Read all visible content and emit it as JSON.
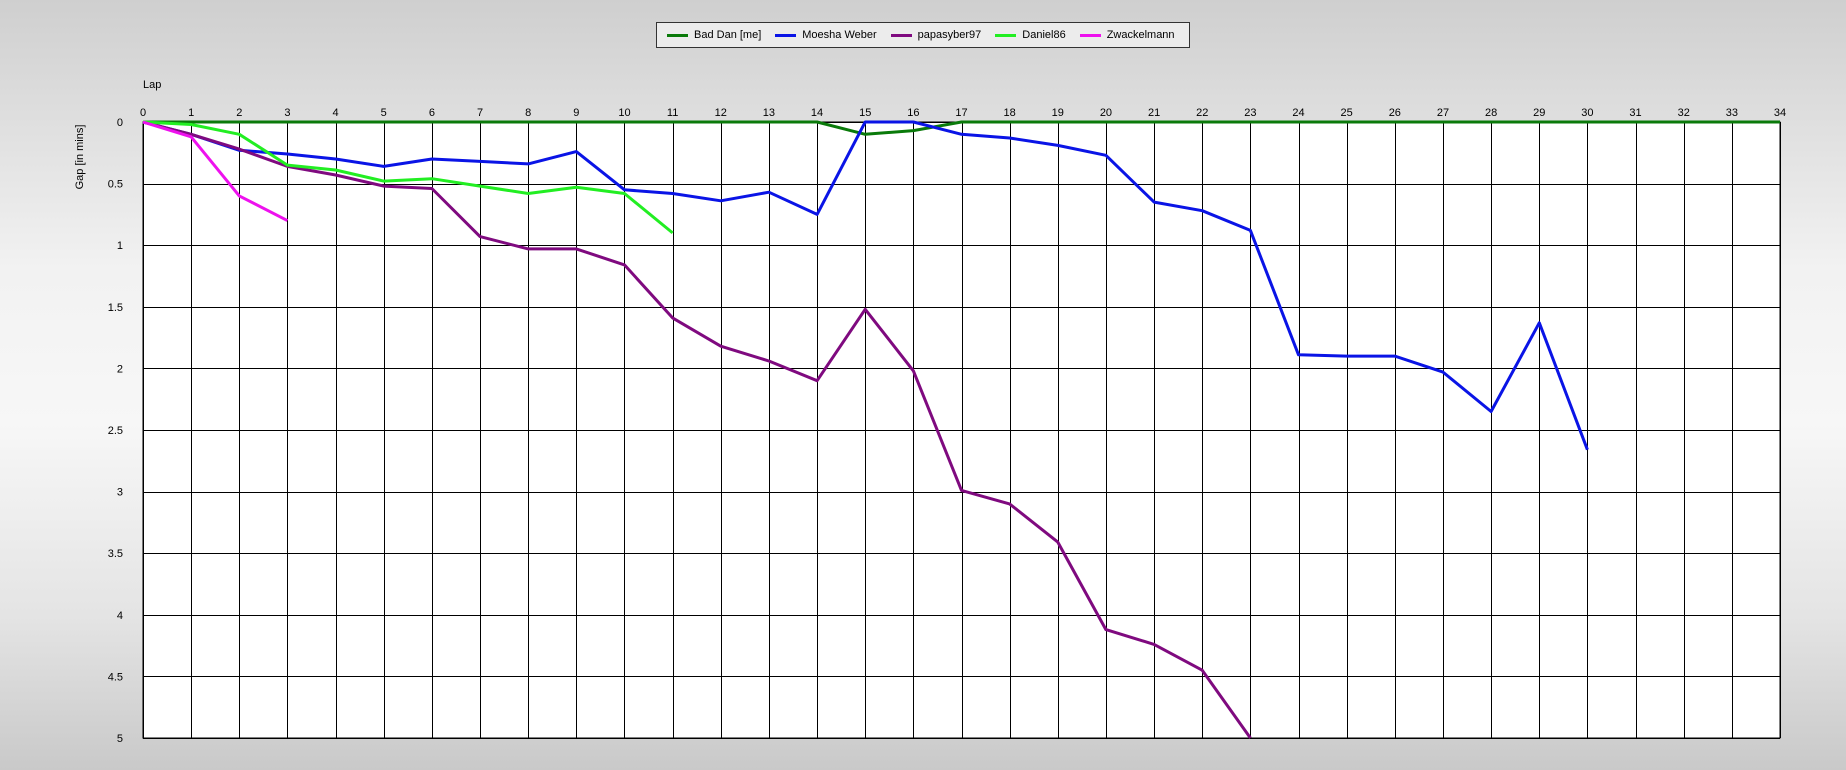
{
  "chart_data": {
    "type": "line",
    "xlabel": "Lap",
    "ylabel": "Gap [in mins]",
    "xlim": [
      0,
      34
    ],
    "ylim": [
      0,
      5
    ],
    "x_ticks": [
      0,
      1,
      2,
      3,
      4,
      5,
      6,
      7,
      8,
      9,
      10,
      11,
      12,
      13,
      14,
      15,
      16,
      17,
      18,
      19,
      20,
      21,
      22,
      23,
      24,
      25,
      26,
      27,
      28,
      29,
      30,
      31,
      32,
      33,
      34
    ],
    "y_ticks": [
      0,
      0.5,
      1,
      1.5,
      2,
      2.5,
      3,
      3.5,
      4,
      4.5,
      5
    ],
    "grid": true,
    "legend_position": "top-center",
    "y_axis_inverted": true,
    "series": [
      {
        "name": "Bad Dan [me]",
        "color": "#0a7a0a",
        "points": [
          [
            0,
            0
          ],
          [
            1,
            0
          ],
          [
            2,
            0
          ],
          [
            3,
            0
          ],
          [
            4,
            0
          ],
          [
            5,
            0
          ],
          [
            6,
            0
          ],
          [
            7,
            0
          ],
          [
            8,
            0
          ],
          [
            9,
            0
          ],
          [
            10,
            0
          ],
          [
            11,
            0
          ],
          [
            12,
            0
          ],
          [
            13,
            0
          ],
          [
            14,
            0
          ],
          [
            15,
            0.1
          ],
          [
            16,
            0.07
          ],
          [
            17,
            0
          ],
          [
            18,
            0
          ],
          [
            19,
            0
          ],
          [
            20,
            0
          ],
          [
            21,
            0
          ],
          [
            22,
            0
          ],
          [
            23,
            0
          ],
          [
            24,
            0
          ],
          [
            25,
            0
          ],
          [
            26,
            0
          ],
          [
            27,
            0
          ],
          [
            28,
            0
          ],
          [
            29,
            0
          ],
          [
            30,
            0
          ],
          [
            31,
            0
          ],
          [
            32,
            0
          ],
          [
            33,
            0
          ],
          [
            34,
            0
          ]
        ]
      },
      {
        "name": "Moesha Weber",
        "color": "#0a14e6",
        "points": [
          [
            0,
            0
          ],
          [
            1,
            0.1
          ],
          [
            2,
            0.23
          ],
          [
            3,
            0.26
          ],
          [
            4,
            0.3
          ],
          [
            5,
            0.36
          ],
          [
            6,
            0.3
          ],
          [
            7,
            0.32
          ],
          [
            8,
            0.34
          ],
          [
            9,
            0.24
          ],
          [
            10,
            0.55
          ],
          [
            11,
            0.58
          ],
          [
            12,
            0.64
          ],
          [
            13,
            0.57
          ],
          [
            14,
            0.75
          ],
          [
            15,
            0
          ],
          [
            16,
            0
          ],
          [
            17,
            0.1
          ],
          [
            18,
            0.13
          ],
          [
            19,
            0.19
          ],
          [
            20,
            0.27
          ],
          [
            21,
            0.65
          ],
          [
            22,
            0.72
          ],
          [
            23,
            0.88
          ],
          [
            24,
            1.89
          ],
          [
            25,
            1.9
          ],
          [
            26,
            1.9
          ],
          [
            27,
            2.03
          ],
          [
            28,
            2.35
          ],
          [
            29,
            1.63
          ],
          [
            30,
            2.66
          ]
        ]
      },
      {
        "name": "papasyber97",
        "color": "#7f0a7f",
        "points": [
          [
            0,
            0
          ],
          [
            1,
            0.1
          ],
          [
            2,
            0.22
          ],
          [
            3,
            0.36
          ],
          [
            4,
            0.43
          ],
          [
            5,
            0.52
          ],
          [
            6,
            0.54
          ],
          [
            7,
            0.93
          ],
          [
            8,
            1.03
          ],
          [
            9,
            1.03
          ],
          [
            10,
            1.16
          ],
          [
            11,
            1.59
          ],
          [
            12,
            1.82
          ],
          [
            13,
            1.94
          ],
          [
            14,
            2.1
          ],
          [
            15,
            1.52
          ],
          [
            16,
            2.02
          ],
          [
            17,
            2.99
          ],
          [
            18,
            3.1
          ],
          [
            19,
            3.41
          ],
          [
            20,
            4.12
          ],
          [
            21,
            4.24
          ],
          [
            22,
            4.45
          ],
          [
            23,
            5.0
          ]
        ]
      },
      {
        "name": "Daniel86",
        "color": "#22ee22",
        "points": [
          [
            0,
            0
          ],
          [
            1,
            0.02
          ],
          [
            2,
            0.1
          ],
          [
            3,
            0.35
          ],
          [
            4,
            0.39
          ],
          [
            5,
            0.48
          ],
          [
            6,
            0.46
          ],
          [
            7,
            0.52
          ],
          [
            8,
            0.58
          ],
          [
            9,
            0.53
          ],
          [
            10,
            0.58
          ],
          [
            11,
            0.9
          ]
        ]
      },
      {
        "name": "Zwackelmann",
        "color": "#ee11ee",
        "points": [
          [
            0,
            0
          ],
          [
            1,
            0.12
          ],
          [
            2,
            0.6
          ],
          [
            3,
            0.8
          ]
        ]
      }
    ]
  }
}
